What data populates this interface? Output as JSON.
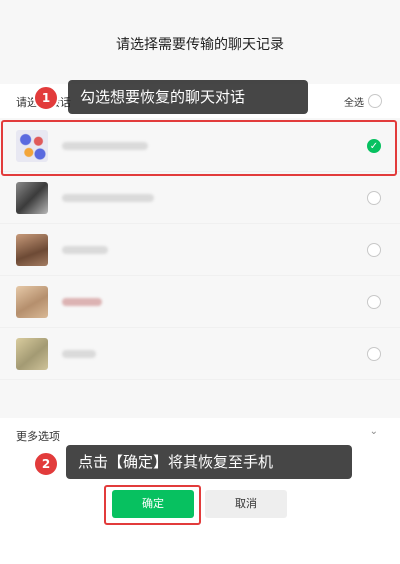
{
  "dialog": {
    "title": "请选择需要传输的聊天记录"
  },
  "header": {
    "label": "请选择会话",
    "select_all": "全选"
  },
  "conversations": [
    {
      "checked": true
    },
    {
      "checked": false
    },
    {
      "checked": false
    },
    {
      "checked": false
    },
    {
      "checked": false
    }
  ],
  "more": {
    "label": "更多选项"
  },
  "buttons": {
    "confirm": "确定",
    "cancel": "取消"
  },
  "annotations": {
    "step1": {
      "number": "1",
      "text": "勾选想要恢复的聊天对话"
    },
    "step2": {
      "number": "2",
      "text": "点击【确定】将其恢复至手机"
    }
  },
  "colors": {
    "accent": "#07c160",
    "highlight": "#e23b3b"
  }
}
